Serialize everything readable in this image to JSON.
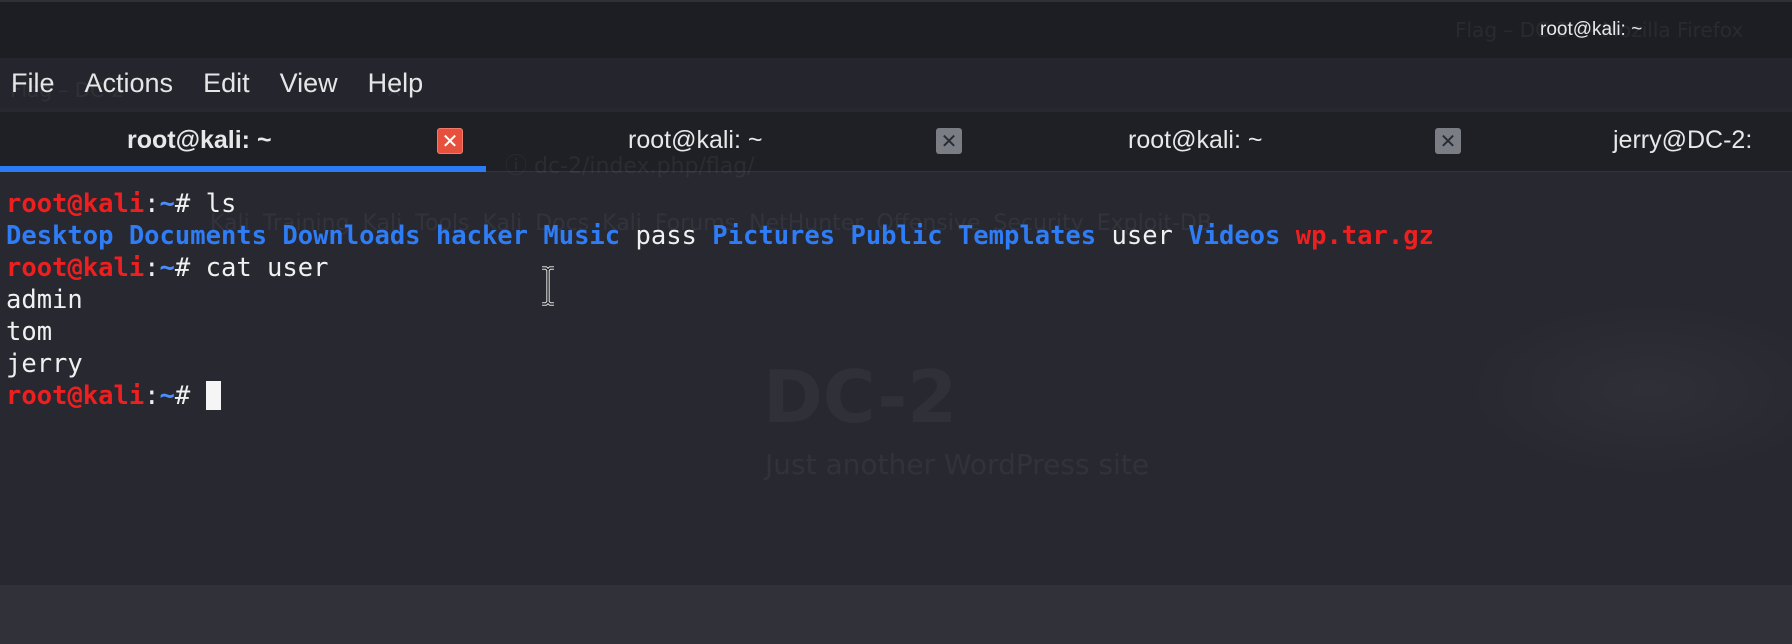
{
  "window": {
    "title": "root@kali: ~"
  },
  "background_firefox": {
    "title": "Flag – DC-2 — Mozilla Firefox",
    "tab_label": "Flag – DC-2",
    "tab_close": "×",
    "url": "ⓘ dc-2/index.php/flag/",
    "bookmarks": "Kali Training   Kali Tools   Kali Docs   Kali Forums   NetHunter   Offensive Security   Exploit-DB",
    "site_title": "DC-2",
    "site_subtitle": "Just another WordPress site"
  },
  "menu": {
    "items": [
      "File",
      "Actions",
      "Edit",
      "View",
      "Help"
    ]
  },
  "tabs": [
    {
      "label": "root@kali: ~",
      "close": "✕",
      "active": true
    },
    {
      "label": "root@kali: ~",
      "close": "✕",
      "active": false
    },
    {
      "label": "root@kali: ~",
      "close": "✕",
      "active": false
    },
    {
      "label": "jerry@DC-2:",
      "close": "",
      "active": false
    }
  ],
  "terminal": {
    "prompt": {
      "user": "root@kali",
      "colon": ":",
      "path": "~",
      "hash": "# "
    },
    "cmd1": "ls",
    "ls_output": [
      {
        "name": "Desktop",
        "kind": "dir"
      },
      {
        "name": "Documents",
        "kind": "dir"
      },
      {
        "name": "Downloads",
        "kind": "dir"
      },
      {
        "name": "hacker",
        "kind": "dir"
      },
      {
        "name": "Music",
        "kind": "dir"
      },
      {
        "name": "pass",
        "kind": "file"
      },
      {
        "name": "Pictures",
        "kind": "dir"
      },
      {
        "name": "Public",
        "kind": "dir"
      },
      {
        "name": "Templates",
        "kind": "dir"
      },
      {
        "name": "user",
        "kind": "file"
      },
      {
        "name": "Videos",
        "kind": "dir"
      },
      {
        "name": "wp.tar.gz",
        "kind": "archive"
      }
    ],
    "cmd2": "cat user",
    "cat_output": [
      "admin",
      "tom",
      "jerry"
    ]
  },
  "colors": {
    "prompt_user": "#ef1f1f",
    "prompt_path": "#4d8cff",
    "directory": "#2f7df6",
    "archive": "#ef1f1f",
    "active_tab_underline": "#2a7bf4",
    "active_tab_close": "#e7503d"
  }
}
